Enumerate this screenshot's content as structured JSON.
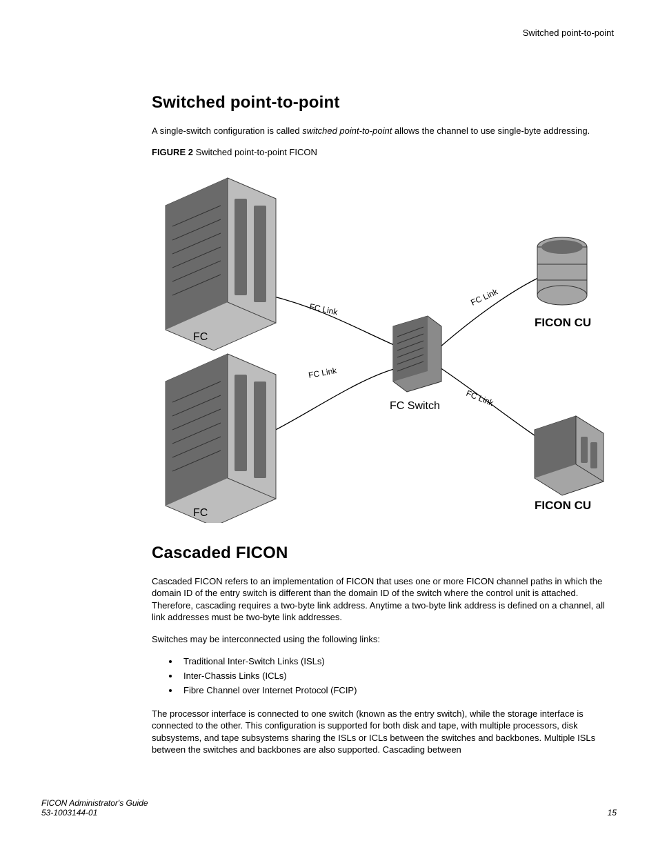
{
  "running_header": "Switched point-to-point",
  "section1": {
    "heading": "Switched point-to-point",
    "para1_a": "A single-switch configuration is called ",
    "para1_italic": "switched point-to-point",
    "para1_b": " allows the channel to use single-byte addressing.",
    "figure_label": "FIGURE 2",
    "figure_caption": " Switched point-to-point FICON"
  },
  "figure": {
    "fc_left_top": "FC",
    "fc_left_bottom": "FC",
    "fc_switch": "FC Switch",
    "ficon_cu_top": "FICON CU",
    "ficon_cu_bottom": "FICON CU",
    "fc_link_1": "FC Link",
    "fc_link_2": "FC Link",
    "fc_link_3": "FC Link",
    "fc_link_4": "FC Link"
  },
  "section2": {
    "heading": "Cascaded FICON",
    "para1": "Cascaded FICON refers to an implementation of FICON that uses one or more FICON channel paths in which the domain ID of the entry switch is different than the domain ID of the switch where the control unit is attached. Therefore, cascading requires a two-byte link address. Anytime a two-byte link address is defined on a channel, all link addresses must be two-byte link addresses.",
    "para2": "Switches may be interconnected using the following links:",
    "bullets": [
      "Traditional Inter-Switch Links (ISLs)",
      "Inter-Chassis Links (ICLs)",
      "Fibre Channel over Internet Protocol (FCIP)"
    ],
    "para3": "The processor interface is connected to one switch (known as the entry switch), while the storage interface is connected to the other. This configuration is supported for both disk and tape, with multiple processors, disk subsystems, and tape subsystems sharing the ISLs or ICLs between the switches and backbones. Multiple ISLs between the switches and backbones are also supported. Cascading between"
  },
  "footer": {
    "guide": "FICON Administrator's Guide",
    "docnum": "53-1003144-01",
    "page": "15"
  }
}
